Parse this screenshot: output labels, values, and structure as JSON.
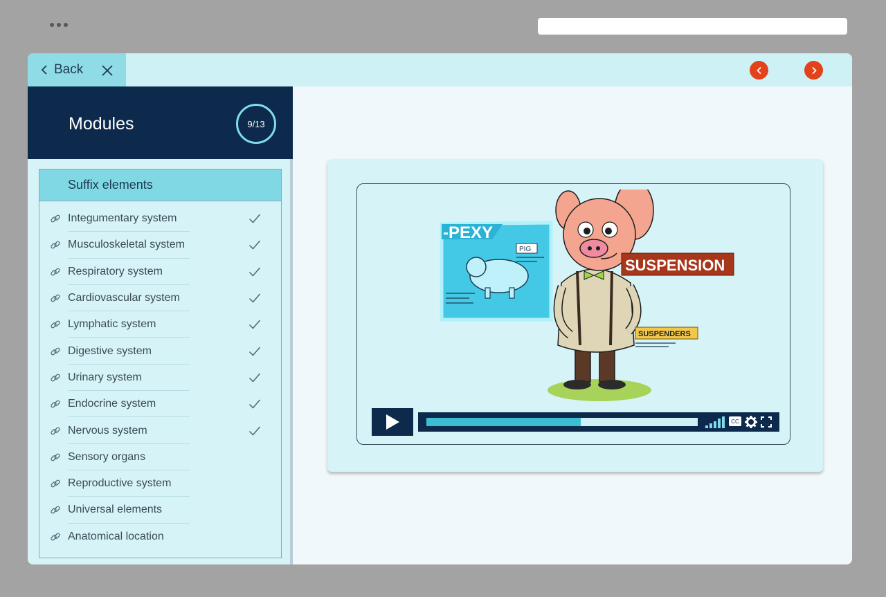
{
  "nav": {
    "back_label": "Back"
  },
  "sidebar": {
    "title": "Modules",
    "progress": "9/13",
    "section_title": "Suffix elements",
    "items": [
      {
        "label": "Integumentary system",
        "done": true
      },
      {
        "label": "Musculoskeletal system",
        "done": true
      },
      {
        "label": "Respiratory system",
        "done": true
      },
      {
        "label": "Cardiovascular system",
        "done": true
      },
      {
        "label": "Lymphatic system",
        "done": true
      },
      {
        "label": "Digestive system",
        "done": true
      },
      {
        "label": "Urinary system",
        "done": true
      },
      {
        "label": "Endocrine system",
        "done": true
      },
      {
        "label": "Nervous system",
        "done": true
      },
      {
        "label": "Sensory organs",
        "done": false
      },
      {
        "label": "Reproductive system",
        "done": false
      },
      {
        "label": "Universal elements",
        "done": false
      },
      {
        "label": "Anatomical location",
        "done": false
      }
    ]
  },
  "video": {
    "illustration": {
      "board_title": "-PEXY",
      "board_tag": "PIG",
      "sign_main": "SUSPENSION",
      "sign_sub": "SUSPENDERS"
    },
    "progress_fraction": 0.57,
    "cc_label": "CC"
  },
  "colors": {
    "accent": "#e2421c",
    "navy": "#0d2a4c",
    "cyan": "#80d8e4",
    "progress_fill": "#3cbed1"
  }
}
